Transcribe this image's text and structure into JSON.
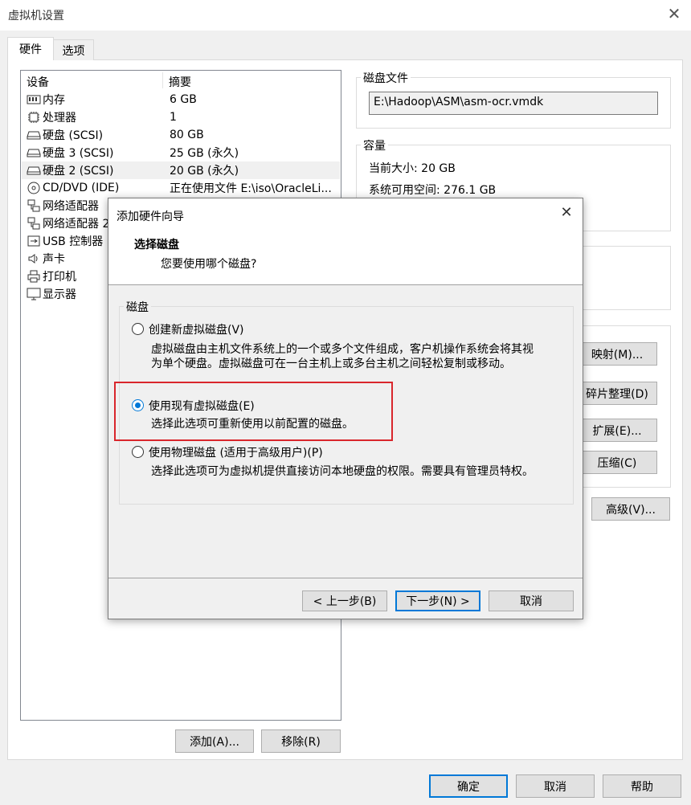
{
  "window": {
    "title": "虚拟机设置",
    "close_icon": "close-icon"
  },
  "tabs": [
    {
      "label": "硬件",
      "active": true
    },
    {
      "label": "选项",
      "active": false
    }
  ],
  "device_list": {
    "headers": {
      "device": "设备",
      "summary": "摘要"
    },
    "items": [
      {
        "name": "内存",
        "summary": "6 GB",
        "icon": "memory-icon"
      },
      {
        "name": "处理器",
        "summary": "1",
        "icon": "processor-icon"
      },
      {
        "name": "硬盘 (SCSI)",
        "summary": "80 GB",
        "icon": "hard-disk-icon"
      },
      {
        "name": "硬盘 3 (SCSI)",
        "summary": "25 GB (永久)",
        "icon": "hard-disk-icon"
      },
      {
        "name": "硬盘 2 (SCSI)",
        "summary": "20 GB (永久)",
        "icon": "hard-disk-icon",
        "selected": true
      },
      {
        "name": "CD/DVD (IDE)",
        "summary": "正在使用文件 E:\\iso\\OracleLi...",
        "icon": "cd-dvd-icon"
      },
      {
        "name": "网络适配器",
        "summary": "",
        "icon": "network-adapter-icon"
      },
      {
        "name": "网络适配器 2",
        "summary": "",
        "icon": "network-adapter-icon"
      },
      {
        "name": "USB 控制器",
        "summary": "",
        "icon": "usb-icon"
      },
      {
        "name": "声卡",
        "summary": "",
        "icon": "sound-card-icon"
      },
      {
        "name": "打印机",
        "summary": "",
        "icon": "printer-icon"
      },
      {
        "name": "显示器",
        "summary": "",
        "icon": "display-icon"
      }
    ],
    "add_button": "添加(A)...",
    "remove_button": "移除(R)"
  },
  "disk_file": {
    "group_title": "磁盘文件",
    "path": "E:\\Hadoop\\ASM\\asm-ocr.vmdk"
  },
  "capacity": {
    "group_title": "容量",
    "current_size": "当前大小: 20 GB",
    "system_free": "系统可用空间: 276.1 GB"
  },
  "utility_buttons": {
    "map": "映射(M)...",
    "defrag": "碎片整理(D)",
    "expand": "扩展(E)...",
    "compact": "压缩(C)",
    "advanced": "高级(V)..."
  },
  "footer": {
    "ok": "确定",
    "cancel": "取消",
    "help": "帮助"
  },
  "wizard": {
    "title": "添加硬件向导",
    "heading": "选择磁盘",
    "subheading": "您要使用哪个磁盘?",
    "group_title": "磁盘",
    "options": [
      {
        "label": "创建新虚拟磁盘(V)",
        "desc_line1": "虚拟磁盘由主机文件系统上的一个或多个文件组成，客户机操作系统会将其视",
        "desc_line2": "为单个硬盘。虚拟磁盘可在一台主机上或多台主机之间轻松复制或移动。",
        "checked": false
      },
      {
        "label": "使用现有虚拟磁盘(E)",
        "desc_line1": "选择此选项可重新使用以前配置的磁盘。",
        "checked": true
      },
      {
        "label": "使用物理磁盘 (适用于高级用户)(P)",
        "desc_line1": "选择此选项可为虚拟机提供直接访问本地硬盘的权限。需要具有管理员特权。",
        "checked": false
      }
    ],
    "back_button": "< 上一步(B)",
    "next_button": "下一步(N) >",
    "cancel_button": "取消",
    "highlight_color": "#d9262c",
    "accent_color": "#0078d7"
  }
}
